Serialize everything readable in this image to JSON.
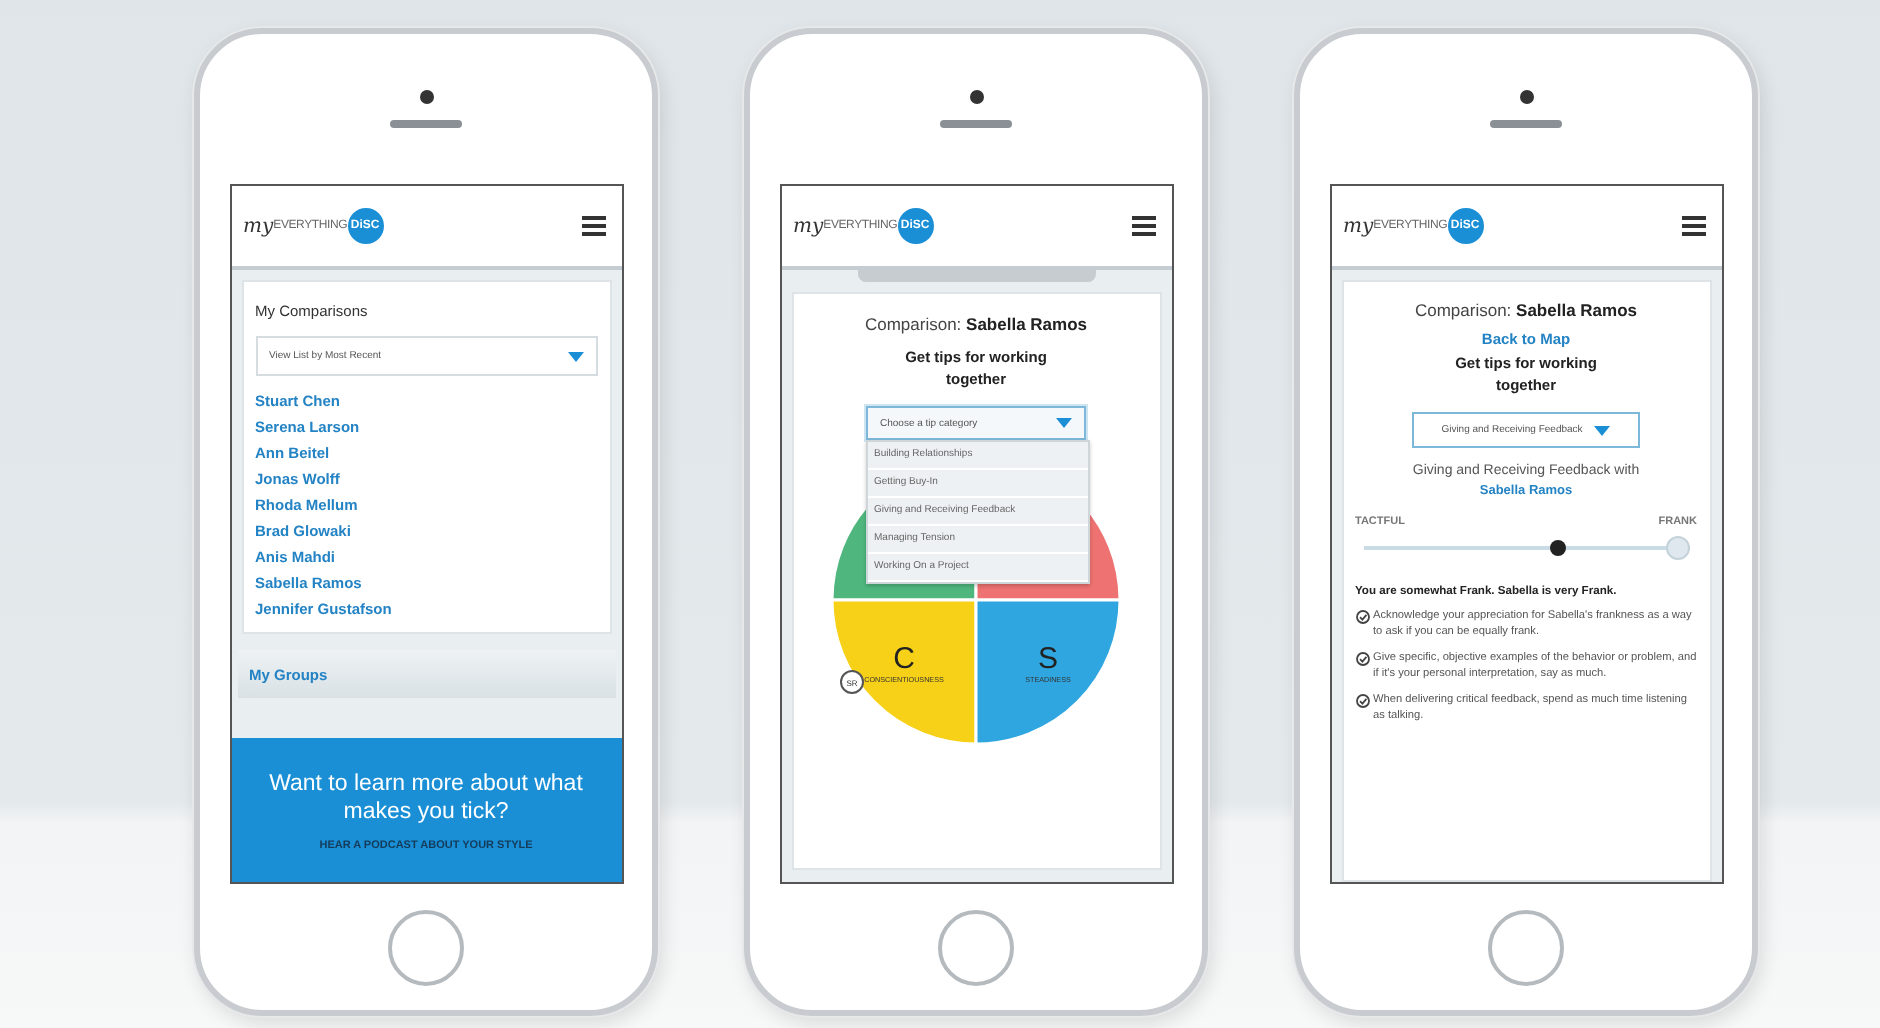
{
  "phones": [
    {
      "kind": "list",
      "logo": {
        "script": "my",
        "word": "EVERYTHING",
        "badge": "DiSC"
      },
      "title": "My Comparisons",
      "filter": "View List by Most Recent",
      "names": [
        "Stuart Chen",
        "Serena Larson",
        "Ann Beitel",
        "Jonas Wolff",
        "Rhoda Mellum",
        "Brad Glowaki",
        "Anis Mahdi",
        "Sabella Ramos",
        "Jennifer Gustafson"
      ],
      "groups": "My Groups",
      "banner": {
        "headline": "Want to learn more about what makes you tick?",
        "link": "HEAR A PODCAST ABOUT YOUR STYLE"
      }
    },
    {
      "kind": "map",
      "logo": {
        "script": "my",
        "word": "EVERYTHING",
        "badge": "DiSC"
      },
      "comparison_label": "Comparison:",
      "comparison_name": "Sabella Ramos",
      "tips_heading": "Get tips for working together",
      "dropdown": {
        "placeholder": "Choose a tip category",
        "expanded": true,
        "options": [
          "Building Relationships",
          "Getting Buy-In",
          "Giving and Receiving Feedback",
          "Managing Tension",
          "Working On a Project"
        ]
      },
      "wheel": {
        "quadrants": [
          {
            "color": "#4fb77e"
          },
          {
            "color": "#ee7272"
          },
          {
            "letter": "C",
            "name": "CONSCIENTIOUSNESS",
            "color": "#f7d117"
          },
          {
            "letter": "S",
            "name": "STEADINESS",
            "color": "#2fa6e0"
          }
        ],
        "marker": "SR"
      }
    },
    {
      "kind": "tips",
      "logo": {
        "script": "my",
        "word": "EVERYTHING",
        "badge": "DiSC"
      },
      "comparison_label": "Comparison:",
      "comparison_name": "Sabella Ramos",
      "back_link": "Back to Map",
      "tips_heading": "Get tips for working together",
      "dropdown": {
        "value": "Giving and Receiving Feedback",
        "expanded": false
      },
      "subheading": "Giving and Receiving Feedback with",
      "subject": "Sabella Ramos",
      "scale": {
        "left": "TACTFUL",
        "right": "FRANK",
        "level": 0.6
      },
      "summary": "You are somewhat Frank. Sabella is very Frank.",
      "tips": [
        "Acknowledge your appreciation for Sabella's frankness as a way to ask if you can be equally frank.",
        "Give specific, objective examples of the behavior or problem, and if it's your personal interpretation, say as much.",
        "When delivering critical feedback, spend as much time listening as talking."
      ]
    }
  ]
}
